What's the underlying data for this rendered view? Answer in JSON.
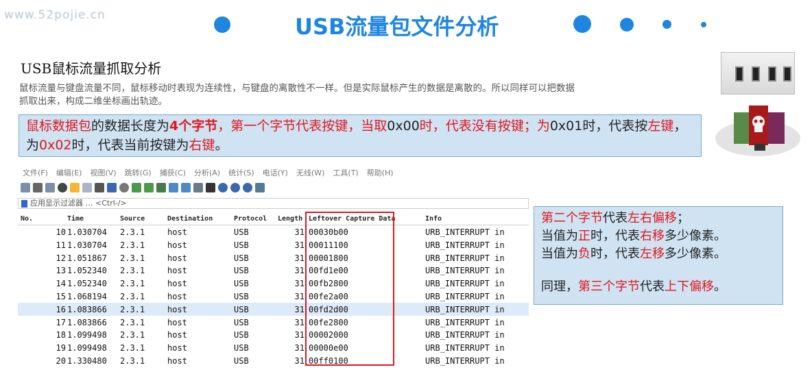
{
  "watermark": "www.52pojie.cn",
  "slide_title": "USB流量包文件分析",
  "section_title": "USB鼠标流量抓取分析",
  "intro_text": "鼠标流量与键盘流量不同，鼠标移动时表现为连续性，与键盘的离散性不一样。但是实际鼠标产生的数据是离散的。所以同样可以把数据抓取出来，构成二维坐标画出轨迹。",
  "red_box": {
    "p1": "鼠标数据包",
    "p2": "的数据长度为",
    "p3": "4个字节",
    "p4": "，第一个字节代表按键，当取",
    "p5": "0x00",
    "p6": "时，代表",
    "p7": "没有按键",
    "p8": "；为",
    "p9": "0x01",
    "p10": "时，代表按",
    "p11": "左键",
    "p12": "，为",
    "p13": "0x02",
    "p14": "时，代表当前按键为",
    "p15": "右键",
    "p16": "。"
  },
  "menu": [
    "文件(F)",
    "编辑(E)",
    "视图(V)",
    "跳转(G)",
    "捕获(C)",
    "分析(A)",
    "统计(S)",
    "电话(Y)",
    "无线(W)",
    "工具(T)",
    "帮助(H)"
  ],
  "filter_placeholder": "应用显示过滤器 … <Ctrl-/>",
  "columns": [
    "No.",
    "Time",
    "Source",
    "Destination",
    "Protocol",
    "Length",
    "Leftover Capture Data",
    "Info"
  ],
  "rows": [
    {
      "no": "10",
      "time": "1.030704",
      "src": "2.3.1",
      "dst": "host",
      "proto": "USB",
      "len": "31",
      "data": "00030b00",
      "info": "URB_INTERRUPT in"
    },
    {
      "no": "11",
      "time": "1.030704",
      "src": "2.3.1",
      "dst": "host",
      "proto": "USB",
      "len": "31",
      "data": "00011100",
      "info": "URB_INTERRUPT in"
    },
    {
      "no": "12",
      "time": "1.051867",
      "src": "2.3.1",
      "dst": "host",
      "proto": "USB",
      "len": "31",
      "data": "00001800",
      "info": "URB_INTERRUPT in"
    },
    {
      "no": "13",
      "time": "1.052340",
      "src": "2.3.1",
      "dst": "host",
      "proto": "USB",
      "len": "31",
      "data": "00fd1e00",
      "info": "URB_INTERRUPT in"
    },
    {
      "no": "14",
      "time": "1.052340",
      "src": "2.3.1",
      "dst": "host",
      "proto": "USB",
      "len": "31",
      "data": "00fb2800",
      "info": "URB_INTERRUPT in"
    },
    {
      "no": "15",
      "time": "1.068194",
      "src": "2.3.1",
      "dst": "host",
      "proto": "USB",
      "len": "31",
      "data": "00fe2a00",
      "info": "URB_INTERRUPT in"
    },
    {
      "no": "16",
      "time": "1.083866",
      "src": "2.3.1",
      "dst": "host",
      "proto": "USB",
      "len": "31",
      "data": "00fd2d00",
      "info": "URB_INTERRUPT in"
    },
    {
      "no": "17",
      "time": "1.083866",
      "src": "2.3.1",
      "dst": "host",
      "proto": "USB",
      "len": "31",
      "data": "00fe2800",
      "info": "URB_INTERRUPT in"
    },
    {
      "no": "18",
      "time": "1.099498",
      "src": "2.3.1",
      "dst": "host",
      "proto": "USB",
      "len": "31",
      "data": "00002000",
      "info": "URB_INTERRUPT in"
    },
    {
      "no": "19",
      "time": "1.099498",
      "src": "2.3.1",
      "dst": "host",
      "proto": "USB",
      "len": "31",
      "data": "00000e00",
      "info": "URB_INTERRUPT in"
    },
    {
      "no": "20",
      "time": "1.330480",
      "src": "2.3.1",
      "dst": "host",
      "proto": "USB",
      "len": "31",
      "data": "00ff0100",
      "info": "URB_INTERRUPT in"
    }
  ],
  "selected_row": 6,
  "right_box": {
    "l1a": "第二个字节",
    "l1b": "代表",
    "l1c": "左右偏移",
    "l1d": "；",
    "l2a": "当值为",
    "l2b": "正",
    "l2c": "时，代表",
    "l2d": "右移",
    "l2e": "多少像素。",
    "l3a": "当值为",
    "l3b": "负",
    "l3c": "时，代表",
    "l3d": "左移",
    "l3e": "多少像素。",
    "l4a": "同理，",
    "l4b": "第三个字节",
    "l4c": "代表",
    "l4d": "上下偏移",
    "l4e": "。"
  },
  "colors": {
    "accent": "#1f86df",
    "highlight": "#e0161d",
    "box_bg": "#cfe3f3"
  },
  "icons": [
    "usb-ports-photo",
    "skull-usb-photo"
  ]
}
